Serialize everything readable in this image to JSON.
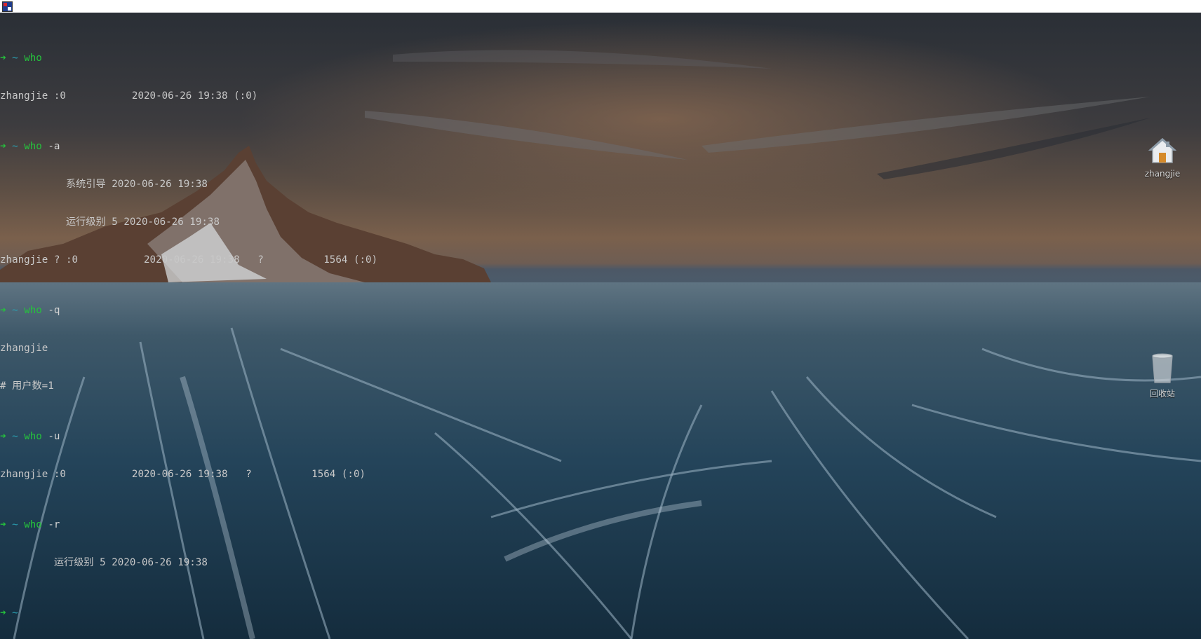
{
  "terminal": {
    "lines": [
      {
        "type": "prompt",
        "arrow": "➜",
        "dir": "~",
        "cmd": "who",
        "args": ""
      },
      {
        "type": "output",
        "text": "zhangjie :0           2020-06-26 19:38 (:0)"
      },
      {
        "type": "prompt",
        "arrow": "➜",
        "dir": "~",
        "cmd": "who",
        "args": "-a"
      },
      {
        "type": "output",
        "text": "           系统引导 2020-06-26 19:38"
      },
      {
        "type": "output",
        "text": "           运行级别 5 2020-06-26 19:38"
      },
      {
        "type": "output",
        "text": "zhangjie ? :0           2020-06-26 19:38   ?          1564 (:0)"
      },
      {
        "type": "prompt",
        "arrow": "➜",
        "dir": "~",
        "cmd": "who",
        "args": "-q"
      },
      {
        "type": "output",
        "text": "zhangjie"
      },
      {
        "type": "output",
        "text": "# 用户数=1"
      },
      {
        "type": "prompt",
        "arrow": "➜",
        "dir": "~",
        "cmd": "who",
        "args": "-u"
      },
      {
        "type": "output",
        "text": "zhangjie :0           2020-06-26 19:38   ?          1564 (:0)"
      },
      {
        "type": "prompt",
        "arrow": "➜",
        "dir": "~",
        "cmd": "who",
        "args": "-r"
      },
      {
        "type": "output",
        "text": "         运行级别 5 2020-06-26 19:38"
      },
      {
        "type": "prompt",
        "arrow": "➜",
        "dir": "~",
        "cmd": "",
        "args": ""
      }
    ]
  },
  "desktop": {
    "home": {
      "label": "zhangjie",
      "icon": "home-folder-icon"
    },
    "trash": {
      "label": "回收站",
      "icon": "trash-icon"
    }
  },
  "colors": {
    "prompt_arrow": "#25c23c",
    "prompt_dir": "#2aa1b3",
    "output_text": "#c8c8c8"
  }
}
